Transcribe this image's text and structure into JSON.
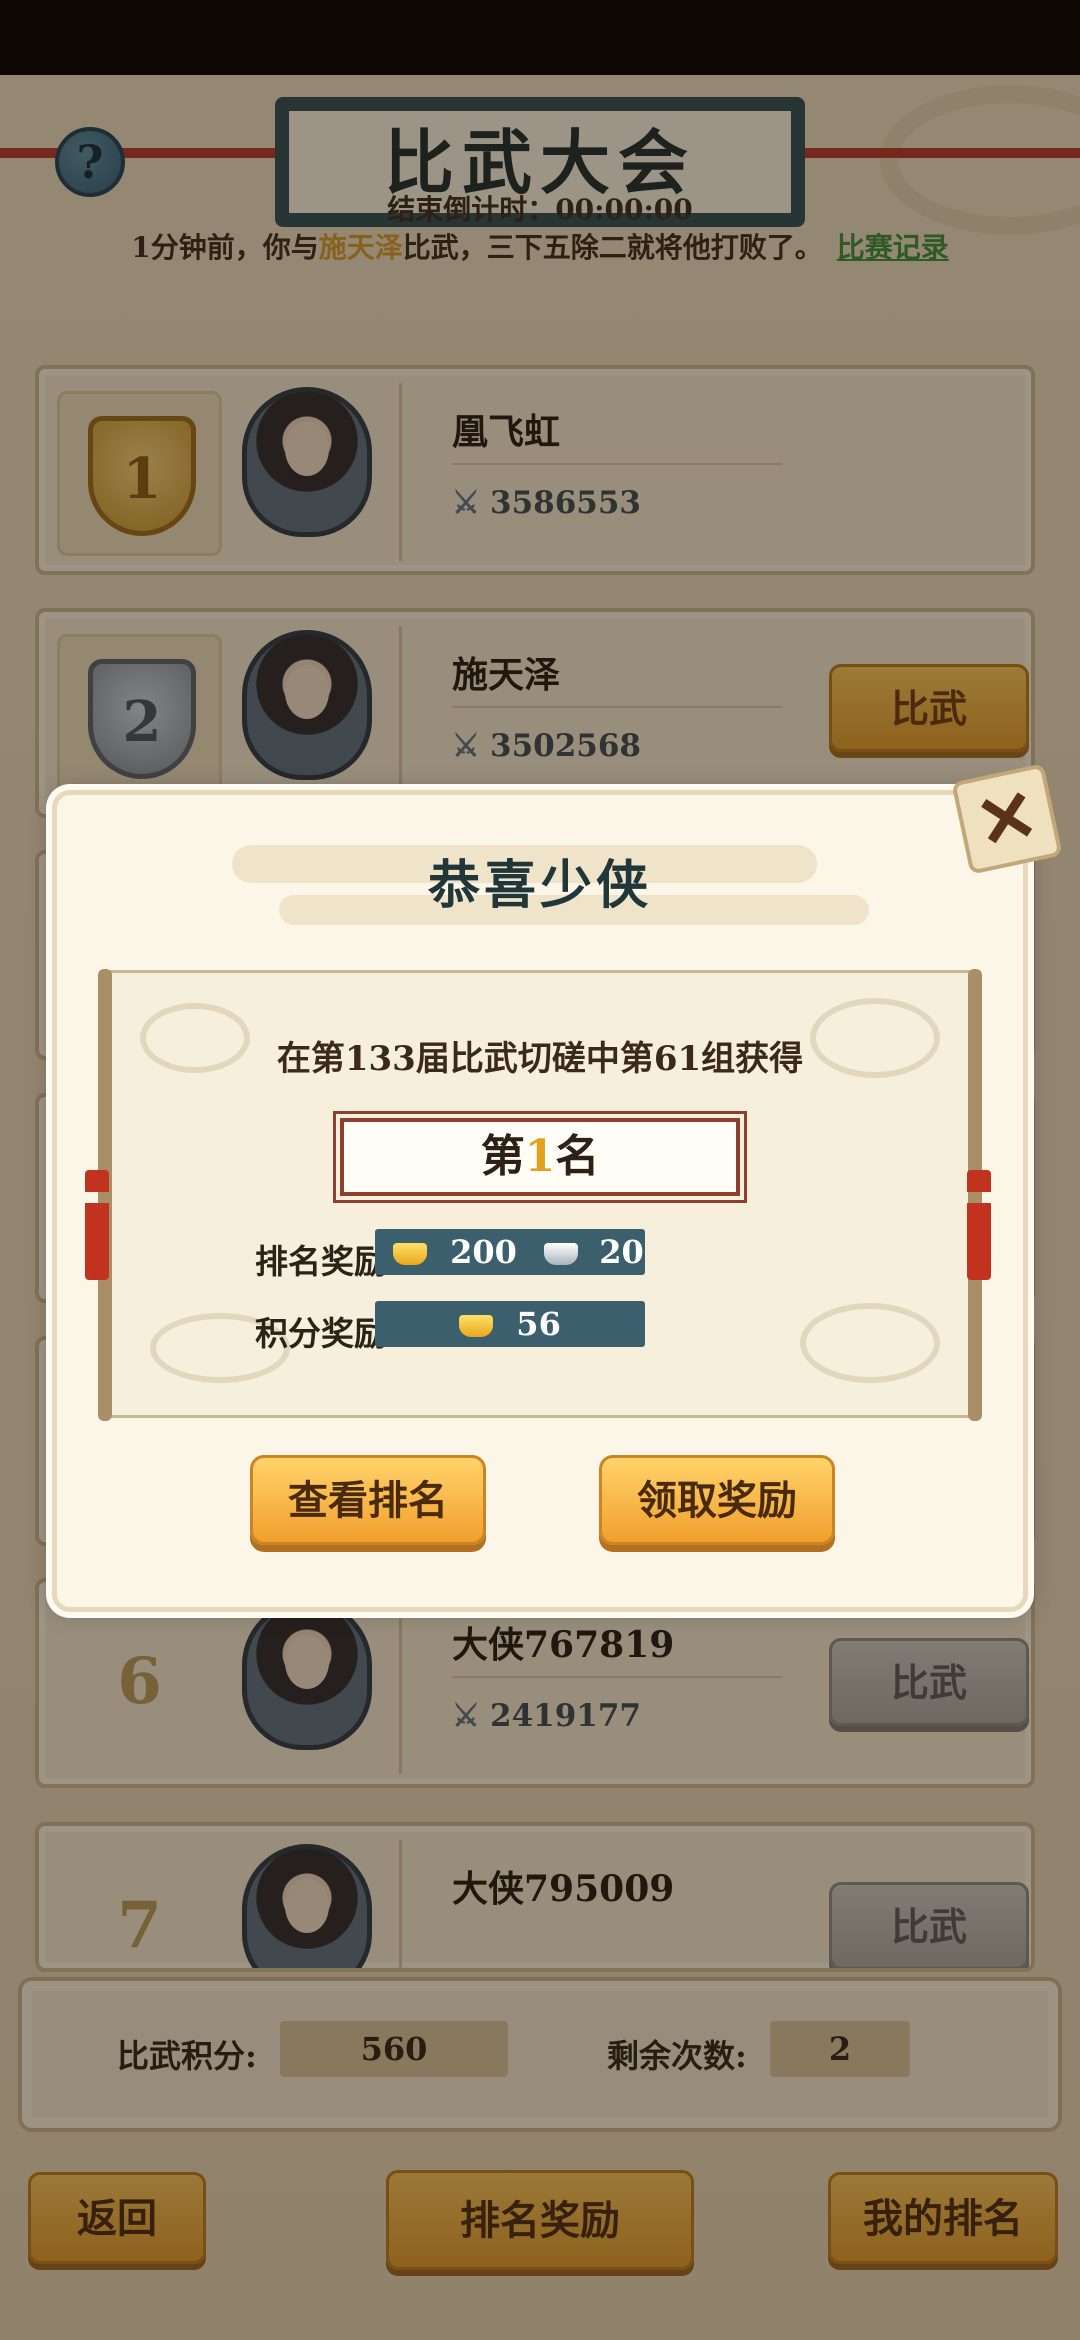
{
  "header": {
    "title": "比武大会",
    "help_icon": "?"
  },
  "countdown": "结束倒计时：00:00:00",
  "battle_log": {
    "prefix": "1分钟前，你与",
    "opponent": "施天泽",
    "suffix": "比武，三下五除二就将他打败了。",
    "record_link": "比赛记录"
  },
  "rankings": [
    {
      "rank": "1",
      "name": "凰飞虹",
      "power": "3586553",
      "button": ""
    },
    {
      "rank": "2",
      "name": "施天泽",
      "power": "3502568",
      "button": "比武"
    },
    {
      "rank": "6",
      "name": "大侠767819",
      "power": "2419177",
      "button": "比武"
    },
    {
      "rank": "7",
      "name": "大侠795009",
      "power": "",
      "button": "比武"
    }
  ],
  "footer_stats": {
    "score_label": "比武积分:",
    "score_value": "560",
    "remaining_label": "剩余次数:",
    "remaining_value": "2"
  },
  "bottom_buttons": {
    "back": "返回",
    "rank_reward": "排名奖励",
    "my_rank": "我的排名"
  },
  "dialog": {
    "title": "恭喜少侠",
    "award_line": "在第133届比武切磋中第61组获得",
    "place_prefix": "第",
    "place_number": "1",
    "place_suffix": "名",
    "rank_reward_label": "排名奖励:",
    "rank_reward_gold": "200",
    "rank_reward_silver": "20",
    "points_reward_label": "积分奖励:",
    "points_reward_gold": "56",
    "view_rank_button": "查看排名",
    "claim_button": "领取奖励",
    "close_icon": "✕"
  },
  "colors": {
    "accent_gold": "#e2a21f",
    "opponent_highlight": "#d39b2d",
    "record_link": "#3c8d3c",
    "reward_box": "#3b5f6c"
  }
}
